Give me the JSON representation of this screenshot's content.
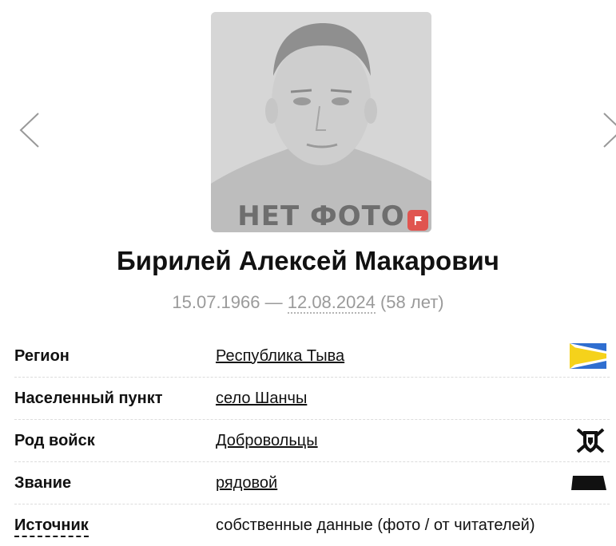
{
  "photo": {
    "placeholder_text": "НЕТ ФОТО",
    "flag_icon": "flag-icon"
  },
  "person": {
    "name": "Бирилей Алексей Макарович",
    "birth_date": "15.07.1966",
    "separator": " — ",
    "death_date": "12.08.2024",
    "age": " (58 лет)"
  },
  "details": {
    "region": {
      "label": "Регион",
      "value": "Республика Тыва",
      "icon": "tuva-flag-icon"
    },
    "locality": {
      "label": "Населенный пункт",
      "value": "село Шанчы"
    },
    "branch": {
      "label": "Род войск",
      "value": "Добровольцы",
      "icon": "volunteers-emblem-icon"
    },
    "rank": {
      "label": "Звание",
      "value": "рядовой",
      "icon": "rank-insignia-icon"
    },
    "source": {
      "label": "Источник",
      "value": "собственные данные (фото / от читателей)"
    }
  },
  "colors": {
    "flag_button": "#e0544f",
    "tuva_blue": "#2f6ed0",
    "tuva_yellow": "#f5d21b"
  }
}
